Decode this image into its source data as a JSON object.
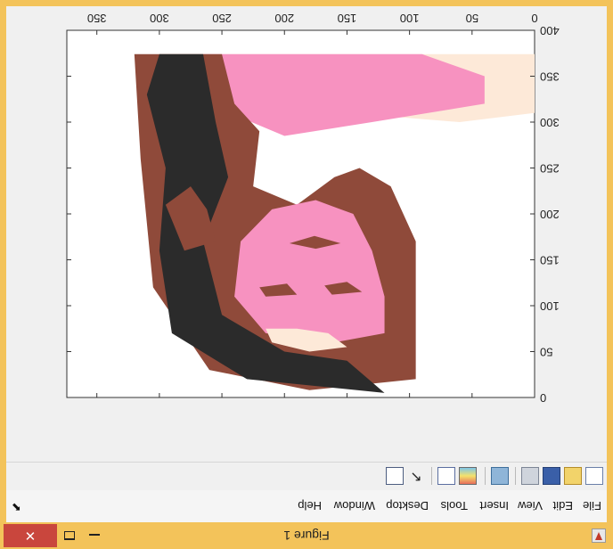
{
  "window": {
    "title": "Figure 1"
  },
  "menu": [
    "File",
    "Edit",
    "View",
    "Insert",
    "Tools",
    "Desktop",
    "Window",
    "Help"
  ],
  "toolbar": {
    "icons": [
      "new-figure-icon",
      "open-file-icon",
      "save-icon",
      "print-icon",
      "link-plot-icon",
      "insert-colorbar-icon",
      "insert-legend-icon",
      "edit-plot-icon",
      "property-inspector-icon"
    ]
  },
  "colors": {
    "titlebar": "#f3c35a",
    "close": "#c9463d",
    "hair": "#2b2b2b",
    "brown": "#8f4a3a",
    "pink": "#f792c0",
    "cream": "#fde9d8",
    "white": "#ffffff"
  },
  "chart_data": {
    "type": "image",
    "x_ticks": [
      0,
      50,
      100,
      150,
      200,
      250,
      300,
      350
    ],
    "y_ticks": [
      0,
      50,
      100,
      150,
      200,
      250,
      300,
      350,
      400
    ],
    "xlim": [
      0,
      374
    ],
    "ylim": [
      0,
      400
    ],
    "color_levels": [
      "#2b2b2b",
      "#8f4a3a",
      "#f792c0",
      "#fde9d8",
      "#ffffff"
    ]
  }
}
